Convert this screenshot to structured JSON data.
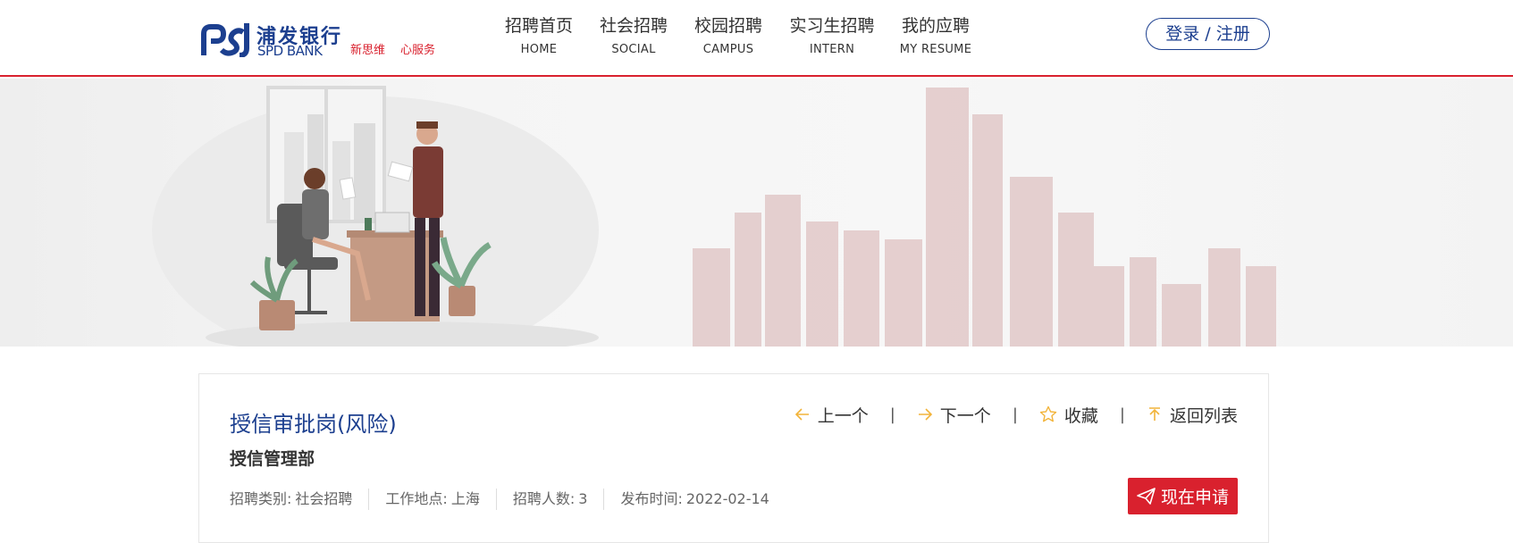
{
  "brand": {
    "name_cn": "浦发银行",
    "name_en": "SPD BANK",
    "slogan_1": "新思维",
    "slogan_2": "心服务",
    "brand_color": "#1c3f8f",
    "accent_color": "#d9212e"
  },
  "nav": [
    {
      "cn": "招聘首页",
      "en": "HOME"
    },
    {
      "cn": "社会招聘",
      "en": "SOCIAL"
    },
    {
      "cn": "校园招聘",
      "en": "CAMPUS"
    },
    {
      "cn": "实习生招聘",
      "en": "INTERN"
    },
    {
      "cn": "我的应聘",
      "en": "MY RESUME"
    }
  ],
  "login_label": "登录 / 注册",
  "job": {
    "title": "授信审批岗(风险)",
    "department": "授信管理部",
    "meta": [
      {
        "label": "招聘类别:",
        "value": "社会招聘"
      },
      {
        "label": "工作地点:",
        "value": "上海"
      },
      {
        "label": "招聘人数:",
        "value": "3"
      },
      {
        "label": "发布时间:",
        "value": "2022-02-14"
      }
    ]
  },
  "actions": {
    "prev": "上一个",
    "next": "下一个",
    "favorite": "收藏",
    "back": "返回列表",
    "separator": "|"
  },
  "apply_label": "现在申请",
  "icons": {
    "prev": "arrow-left-icon",
    "next": "arrow-right-icon",
    "favorite": "star-icon",
    "back": "arrow-up-icon",
    "apply": "paper-plane-icon"
  }
}
